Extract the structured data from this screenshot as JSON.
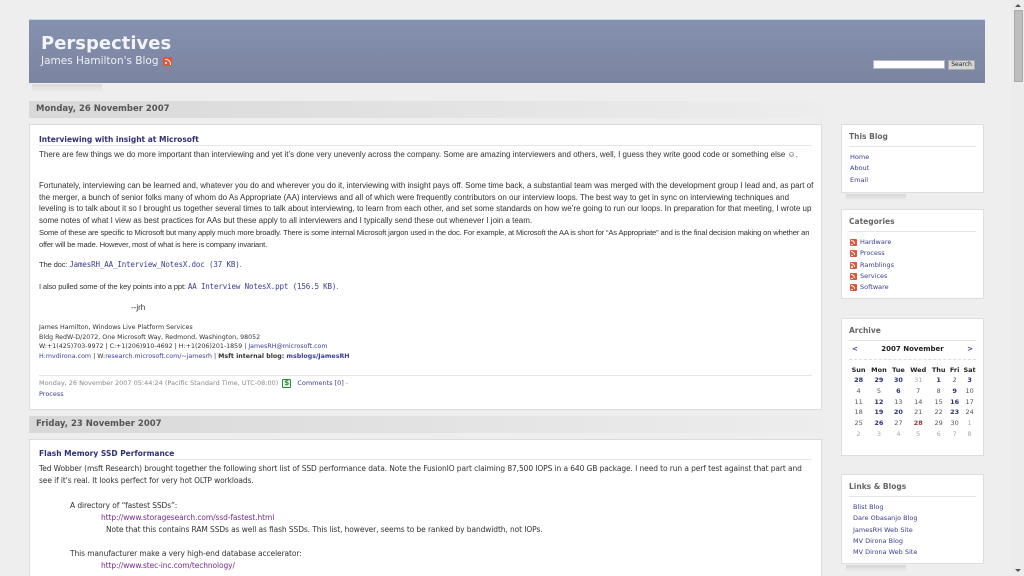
{
  "header": {
    "title": "Perspectives",
    "subtitle": "James Hamilton's Blog",
    "search_placeholder": "",
    "search_button": "Search"
  },
  "posts": [
    {
      "date": "Monday, 26 November 2007",
      "title": "Interviewing with insight at Microsoft",
      "paragraphs": [
        "There are few things we do more important than interviewing and yet it’s done very unevenly across the company.  Some are amazing interviewers and others, well, I guess they write good code or something else ☺.",
        "Fortunately, interviewing can be learned and, whatever you do and wherever you do it, interviewing with insight pays off.  Some time back, a substantial team was merged with the development group I lead and, as part of the merger,  a bunch of senior folks many of whom do As Appropriate (AA) interviews and all of which were frequently contributors on our interview loops.  The best way to get in sync on interviewing techniques and leveling is to talk about it so I brought us together several times to talk about interviewing, to learn from each other, and set some standards on how we’re going to run our loops.  In preparation for that meeting, I wrote up some notes of what I view as best practices for AAs but these apply to all interviewers and I typically send these out whenever I join a team.",
        "Some of these are specific to Microsoft but many apply much more broadly.  There is some internal Microsoft jargon used in the doc.  For example, at Microsoft the AA is short for “As Appropriate” and is the final decision making on whether an offer will be made. However, most of what is here is company invariant."
      ],
      "doc_prefix": "The doc: ",
      "doc_link": "JamesRH_AA_Interview_NotesX.doc (37 KB)",
      "doc_suffix": ".",
      "ppt_prefix": "I also pulled some of the key points into a ppt: ",
      "ppt_link": "AA Interview NotesX.ppt (156.5 KB)",
      "ppt_suffix": ".",
      "signoff": "--jrh",
      "signature": {
        "line1": "James Hamilton, Windows Live Platform Services",
        "line2": "Bldg RedW-D/2072, One Microsoft Way, Redmond, Washington, 98052",
        "line3_prefix": "W:+1(425)703-9972 | C:+1(206)910-4692 | H:+1(206)201-1859 | ",
        "email": "JamesRH@microsoft.com",
        "h_label": "H:",
        "h_link": "mvdirona.com",
        "sep1": " | W:",
        "w_link": "research.microsoft.com/~jamesrh",
        "sep2": " | ",
        "blog_label": "Msft internal blog: ",
        "blog_link": "msblogs/JamesRH"
      },
      "footer": {
        "timestamp": "Monday, 26 November 2007 05:44:24 (Pacific Standard Time, UTC-08:00)",
        "comments": "Comments [0]",
        "sep": " -",
        "category": "Process"
      }
    },
    {
      "date": "Friday, 23 November 2007",
      "title": "Flash Memory SSD Performance",
      "intro": "Ted Wobber (msft Research) brought together the following short list of SSD performance data.  Note the FusionIO part claiming 87,500 IOPS in a 640 GB package.  I need to run a perf test against that part and see if it's real.  It looks perfect for very hot OLTP workloads.",
      "dir_label": "A directory of “fastest SSDs”:",
      "dir_link": "http://www.storagesearch.com/ssd-fastest.html",
      "dir_note": "Note that this contains RAM SSDs as well as flash SSDs.  This list, however, seems to be ranked by bandwidth, not IOPs.",
      "mfr_label": "This manufacturer make a very high-end database accelerator:",
      "mfr_link": "http://www.stec-inc.com/technology/"
    }
  ],
  "sidebar": {
    "this_blog": {
      "title": "This Blog",
      "items": [
        "Home",
        "About",
        "Email"
      ]
    },
    "categories": {
      "title": "Categories",
      "items": [
        "Hardware",
        "Process",
        "Ramblings",
        "Services",
        "Software"
      ]
    },
    "archive": {
      "title": "Archive",
      "prev": "<",
      "next": ">",
      "month": "2007 November",
      "weekdays": [
        "Sun",
        "Mon",
        "Tue",
        "Wed",
        "Thu",
        "Fri",
        "Sat"
      ],
      "weeks": [
        [
          {
            "d": "28",
            "t": "link"
          },
          {
            "d": "29",
            "t": "link"
          },
          {
            "d": "30",
            "t": "link"
          },
          {
            "d": "31",
            "t": "other"
          },
          {
            "d": "1",
            "t": "link"
          },
          {
            "d": "2",
            "t": "plain"
          },
          {
            "d": "3",
            "t": "link"
          }
        ],
        [
          {
            "d": "4",
            "t": "plain"
          },
          {
            "d": "5",
            "t": "plain"
          },
          {
            "d": "6",
            "t": "link"
          },
          {
            "d": "7",
            "t": "plain"
          },
          {
            "d": "8",
            "t": "plain"
          },
          {
            "d": "9",
            "t": "link"
          },
          {
            "d": "10",
            "t": "plain"
          }
        ],
        [
          {
            "d": "11",
            "t": "plain"
          },
          {
            "d": "12",
            "t": "link"
          },
          {
            "d": "13",
            "t": "plain"
          },
          {
            "d": "14",
            "t": "plain"
          },
          {
            "d": "15",
            "t": "plain"
          },
          {
            "d": "16",
            "t": "link"
          },
          {
            "d": "17",
            "t": "plain"
          }
        ],
        [
          {
            "d": "18",
            "t": "plain"
          },
          {
            "d": "19",
            "t": "link"
          },
          {
            "d": "20",
            "t": "link"
          },
          {
            "d": "21",
            "t": "plain"
          },
          {
            "d": "22",
            "t": "plain"
          },
          {
            "d": "23",
            "t": "link"
          },
          {
            "d": "24",
            "t": "plain"
          }
        ],
        [
          {
            "d": "25",
            "t": "plain"
          },
          {
            "d": "26",
            "t": "link"
          },
          {
            "d": "27",
            "t": "plain"
          },
          {
            "d": "28",
            "t": "today"
          },
          {
            "d": "29",
            "t": "plain"
          },
          {
            "d": "30",
            "t": "plain"
          },
          {
            "d": "1",
            "t": "other"
          }
        ],
        [
          {
            "d": "2",
            "t": "other"
          },
          {
            "d": "3",
            "t": "other"
          },
          {
            "d": "4",
            "t": "other"
          },
          {
            "d": "5",
            "t": "other"
          },
          {
            "d": "6",
            "t": "other"
          },
          {
            "d": "7",
            "t": "other"
          },
          {
            "d": "8",
            "t": "other"
          }
        ]
      ]
    },
    "links": {
      "title": "Links & Blogs",
      "items": [
        "Blist Blog",
        "Dare Obasanjo Blog",
        "JamesRH Web Site",
        "MV Dirona Blog",
        "MV Dirona Web Site"
      ]
    }
  }
}
